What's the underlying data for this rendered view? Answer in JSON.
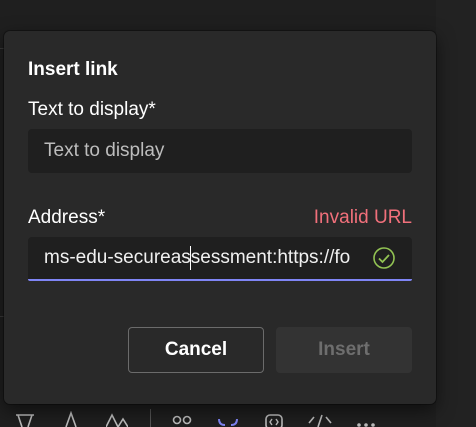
{
  "dialog": {
    "title": "Insert link",
    "text_label": "Text to display*",
    "text_placeholder": "Text to display",
    "address_label": "Address*",
    "address_error": "Invalid URL",
    "address_value_before_caret": "ms-edu-secureas",
    "address_value_after_caret": "sessment:https://fo",
    "validation_icon": "check-circle-icon",
    "cancel_label": "Cancel",
    "insert_label": "Insert"
  },
  "toolbar": {
    "icons": [
      "bucket-icon",
      "font-color-icon",
      "font-size-icon",
      "grid-icon",
      "link-icon",
      "code-snippet-icon",
      "code-icon",
      "more-icon"
    ]
  },
  "colors": {
    "dialog_bg": "#292929",
    "field_bg": "#1f1f1f",
    "accent": "#7f85f5",
    "error": "#f1707b",
    "success": "#92c353"
  }
}
